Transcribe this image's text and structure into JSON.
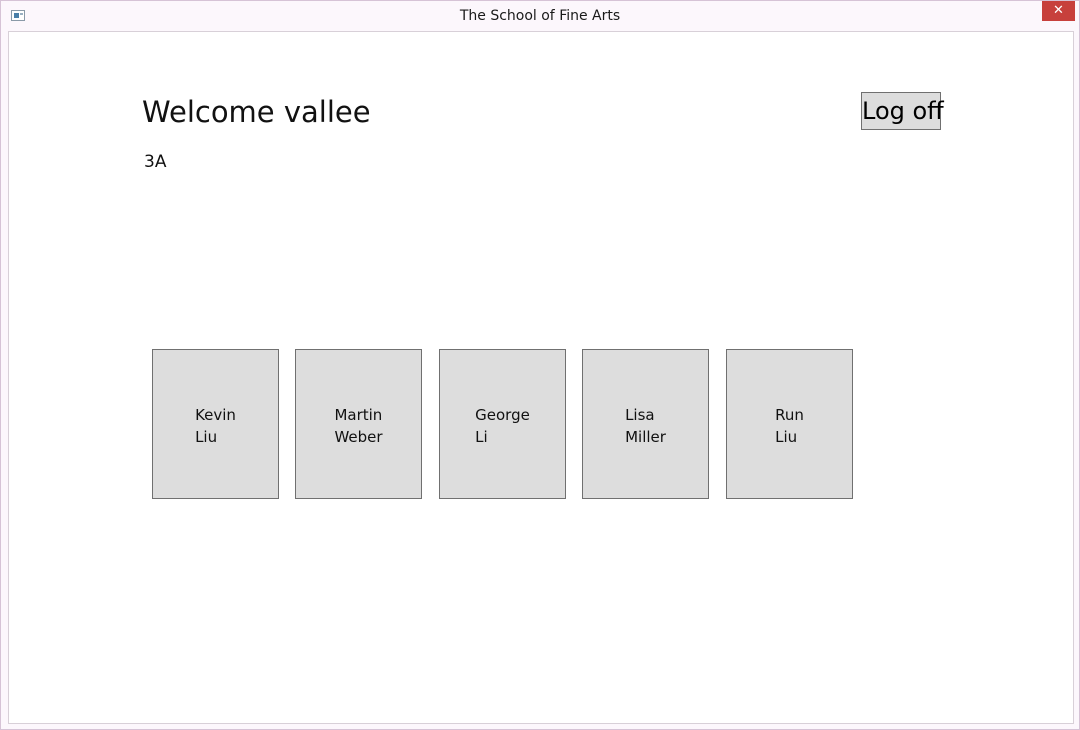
{
  "window": {
    "title": "The School of Fine Arts",
    "close_glyph": "✕"
  },
  "main": {
    "welcome_text": "Welcome vallee",
    "class_name": "3A",
    "logoff_label": "Log off"
  },
  "students": [
    {
      "first": "Kevin",
      "last": "Liu"
    },
    {
      "first": "Martin",
      "last": "Weber"
    },
    {
      "first": "George",
      "last": "Li"
    },
    {
      "first": "Lisa",
      "last": "Miller"
    },
    {
      "first": "Run",
      "last": "Liu"
    }
  ],
  "colors": {
    "tile_background": "#dddddd",
    "tile_border": "#707070",
    "close_button": "#c7403c"
  },
  "icons": {
    "app": "app-window-icon",
    "close": "close-icon"
  }
}
